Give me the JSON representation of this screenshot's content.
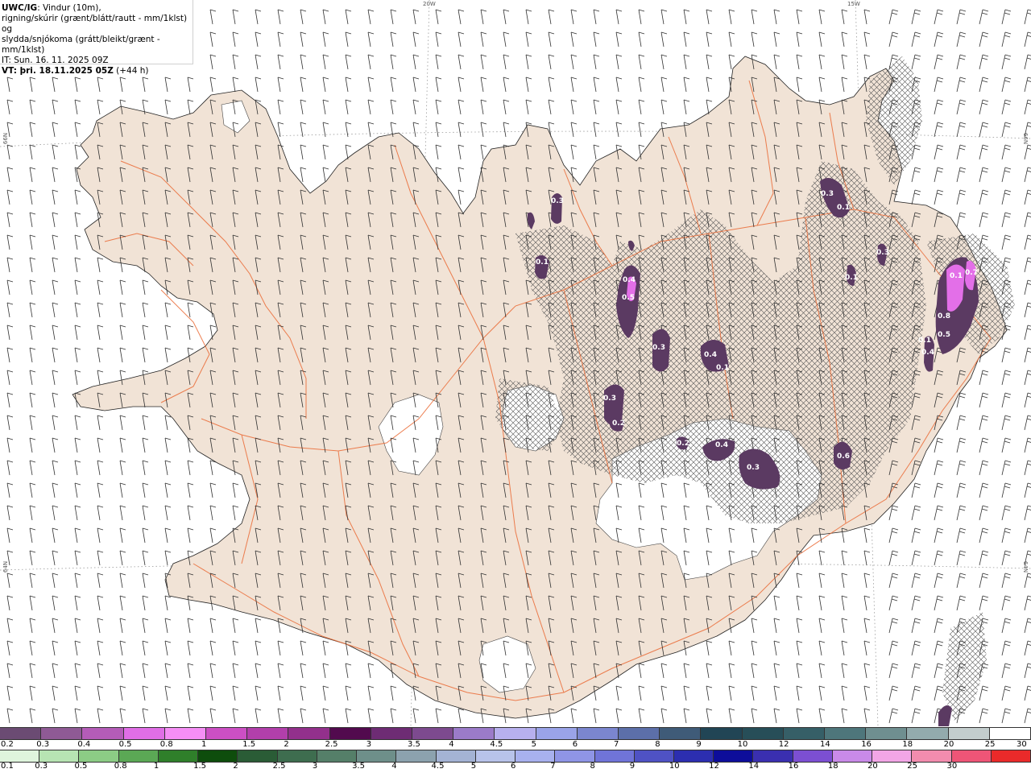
{
  "header": {
    "model": "UWC/IG",
    "line1_rest": ": Vindur (10m),",
    "line2": "rigning/skúrir (grænt/blátt/rautt - mm/1klst) og",
    "line3": "slydda/snjókoma (grátt/bleikt/grænt - mm/1klst)",
    "it": "IT: Sun. 16. 11. 2025 09Z",
    "vt_label": "VT: þri. 18.11.2025 05Z",
    "vt_lead": " (+44 h)"
  },
  "grid_labels": {
    "lon_20w": "20W",
    "lon_15w": "15W",
    "lat_66_left": "66N",
    "lat_66_right": "66N",
    "lat_64_left": "64N",
    "lat_64_right": "64N"
  },
  "precip_cells": [
    {
      "value": "0.3"
    },
    {
      "value": "0.1"
    },
    {
      "value": "0.3"
    },
    {
      "value": "0.1"
    },
    {
      "value": "0.4"
    },
    {
      "value": "0.5"
    },
    {
      "value": "0.3"
    },
    {
      "value": "0.4"
    },
    {
      "value": "0.1"
    },
    {
      "value": "0.3"
    },
    {
      "value": "0.2"
    },
    {
      "value": "0.2"
    },
    {
      "value": "0.4"
    },
    {
      "value": "0.3"
    },
    {
      "value": "0.6"
    },
    {
      "value": "0.3"
    },
    {
      "value": "0.1"
    },
    {
      "value": "0.1"
    },
    {
      "value": "0.7"
    },
    {
      "value": "0.8"
    },
    {
      "value": "0.5"
    },
    {
      "value": "0.4"
    },
    {
      "value": "0.1"
    }
  ],
  "snow_scale": {
    "colors": [
      "#6b4b73",
      "#8f5a95",
      "#b45cb8",
      "#e06ee6",
      "#f58ef5",
      "#cc4fc4",
      "#b23fab",
      "#93308c",
      "#520a4e",
      "#6e2c74",
      "#7d4a8f",
      "#9b7bc9",
      "#b7b0ee",
      "#9aa3e8",
      "#7b86cf",
      "#5c6fa9",
      "#3f5b78",
      "#214555",
      "#274e58",
      "#365f67",
      "#4e767b",
      "#6f8f90",
      "#93abad",
      "#c3cdcd",
      "#ffffff"
    ],
    "ticks": [
      "0.2",
      "0.3",
      "0.4",
      "0.5",
      "0.8",
      "1",
      "1.5",
      "2",
      "2.5",
      "3",
      "3.5",
      "4",
      "4.5",
      "5",
      "6",
      "7",
      "8",
      "9",
      "10",
      "12",
      "14",
      "16",
      "18",
      "20",
      "25",
      "30"
    ]
  },
  "rain_scale": {
    "colors": [
      "#dff5dd",
      "#b7e4b3",
      "#8ccc85",
      "#5ba855",
      "#2f7f2a",
      "#0e4d0c",
      "#2a5c36",
      "#3e6d4f",
      "#557f69",
      "#6e8f8a",
      "#8ca2ae",
      "#a4b3d4",
      "#b8c3ea",
      "#a8b1ee",
      "#8f95e6",
      "#7074d8",
      "#4f52c4",
      "#2c2eb0",
      "#0d0d9a",
      "#3a2fb0",
      "#7c4fd2",
      "#c98ae8",
      "#f2a6e6",
      "#f28cae",
      "#ee5577",
      "#ea2a2a"
    ],
    "ticks": [
      "0.1",
      "0.3",
      "0.5",
      "0.8",
      "1",
      "1.5",
      "2",
      "2.5",
      "3",
      "3.5",
      "4",
      "4.5",
      "5",
      "6",
      "7",
      "8",
      "9",
      "10",
      "12",
      "14",
      "16",
      "18",
      "20",
      "25",
      "30"
    ]
  },
  "colors": {
    "land": "#f1e3d6",
    "glacier": "#ffffff",
    "road": "#ea6a35",
    "precip_dark": "#5b3a62",
    "precip_light": "#e36fe8"
  }
}
